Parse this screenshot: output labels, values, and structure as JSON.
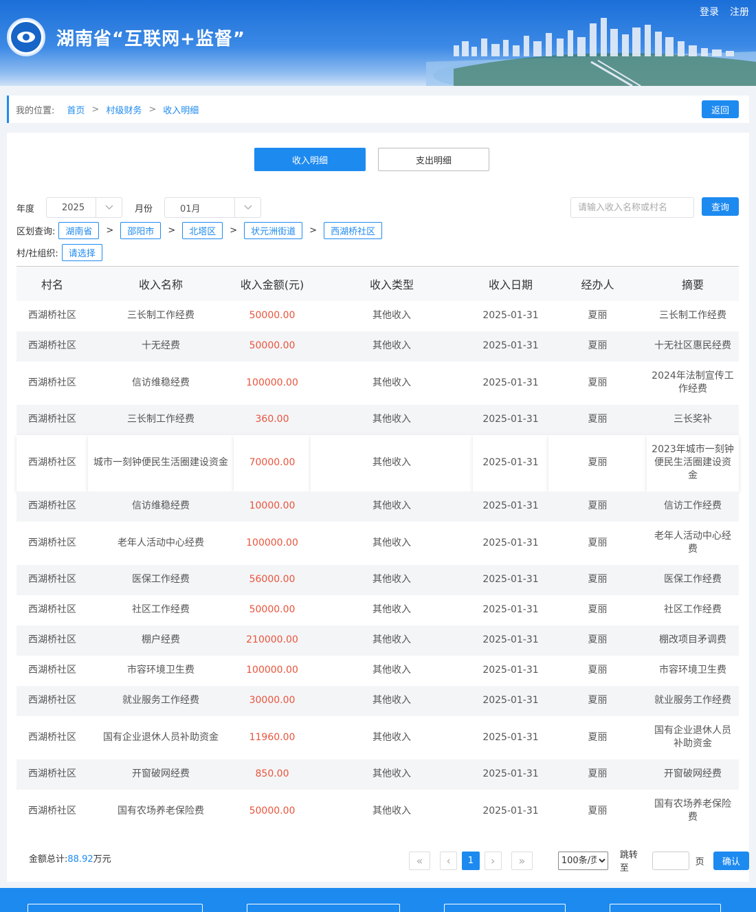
{
  "header": {
    "site_title": "湖南省“互联网+监督”",
    "login": "登录",
    "register": "注册"
  },
  "breadcrumb": {
    "label": "我的位置:",
    "items": [
      "首页",
      "村级财务",
      "收入明细"
    ],
    "separator": ">",
    "back": "返回"
  },
  "tabs": {
    "income": "收入明细",
    "expense": "支出明细"
  },
  "filters": {
    "year_label": "年度",
    "year_value": "2025",
    "month_label": "月份",
    "month_value": "01月",
    "search_placeholder": "请输入收入名称或村名",
    "query": "查询",
    "region_label": "区划查询:",
    "regions": [
      "湖南省",
      "邵阳市",
      "北塔区",
      "状元洲街道",
      "西湖桥社区"
    ],
    "org_label": "村/社组织:",
    "org_select": "请选择"
  },
  "table": {
    "headers": [
      "村名",
      "收入名称",
      "收入金额(元)",
      "收入类型",
      "收入日期",
      "经办人",
      "摘要"
    ],
    "rows": [
      [
        "西湖桥社区",
        "三长制工作经费",
        "50000.00",
        "其他收入",
        "2025-01-31",
        "夏丽",
        "三长制工作经费"
      ],
      [
        "西湖桥社区",
        "十无经费",
        "50000.00",
        "其他收入",
        "2025-01-31",
        "夏丽",
        "十无社区惠民经费"
      ],
      [
        "西湖桥社区",
        "信访维稳经费",
        "100000.00",
        "其他收入",
        "2025-01-31",
        "夏丽",
        "2024年法制宣传工作经费"
      ],
      [
        "西湖桥社区",
        "三长制工作经费",
        "360.00",
        "其他收入",
        "2025-01-31",
        "夏丽",
        "三长奖补"
      ],
      [
        "西湖桥社区",
        "城市一刻钟便民生活圈建设资金",
        "70000.00",
        "其他收入",
        "2025-01-31",
        "夏丽",
        "2023年城市一刻钟便民生活圈建设资金"
      ],
      [
        "西湖桥社区",
        "信访维稳经费",
        "10000.00",
        "其他收入",
        "2025-01-31",
        "夏丽",
        "信访工作经费"
      ],
      [
        "西湖桥社区",
        "老年人活动中心经费",
        "100000.00",
        "其他收入",
        "2025-01-31",
        "夏丽",
        "老年人活动中心经费"
      ],
      [
        "西湖桥社区",
        "医保工作经费",
        "56000.00",
        "其他收入",
        "2025-01-31",
        "夏丽",
        "医保工作经费"
      ],
      [
        "西湖桥社区",
        "社区工作经费",
        "50000.00",
        "其他收入",
        "2025-01-31",
        "夏丽",
        "社区工作经费"
      ],
      [
        "西湖桥社区",
        "棚户经费",
        "210000.00",
        "其他收入",
        "2025-01-31",
        "夏丽",
        "棚改项目矛调费"
      ],
      [
        "西湖桥社区",
        "市容环境卫生费",
        "100000.00",
        "其他收入",
        "2025-01-31",
        "夏丽",
        "市容环境卫生费"
      ],
      [
        "西湖桥社区",
        "就业服务工作经费",
        "30000.00",
        "其他收入",
        "2025-01-31",
        "夏丽",
        "就业服务工作经费"
      ],
      [
        "西湖桥社区",
        "国有企业退休人员补助资金",
        "11960.00",
        "其他收入",
        "2025-01-31",
        "夏丽",
        "国有企业退休人员补助资金"
      ],
      [
        "西湖桥社区",
        "开窗破网经费",
        "850.00",
        "其他收入",
        "2025-01-31",
        "夏丽",
        "开窗破网经费"
      ],
      [
        "西湖桥社区",
        "国有农场养老保险费",
        "50000.00",
        "其他收入",
        "2025-01-31",
        "夏丽",
        "国有农场养老保险费"
      ]
    ]
  },
  "summary": {
    "label": "金额总计:",
    "value": "88.92",
    "unit": "万元"
  },
  "pagination": {
    "first": "«",
    "prev": "‹",
    "current": "1",
    "next": "›",
    "last": "»",
    "per_page": "100条/页",
    "jump_label": "跳转至",
    "page_unit": "页",
    "confirm": "确认"
  },
  "colors": {
    "primary": "#1d8af0",
    "amount": "#e8543c"
  }
}
